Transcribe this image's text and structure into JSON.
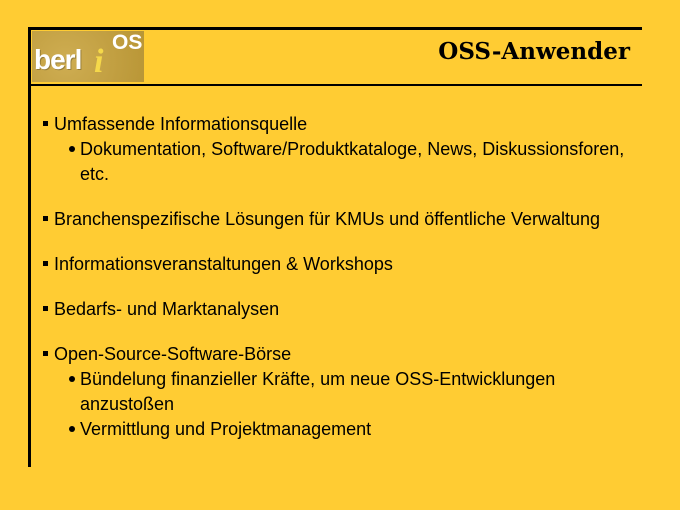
{
  "logo": {
    "text_main": "berl",
    "text_i": "i",
    "text_os": "OS"
  },
  "slide": {
    "title": "OSS-Anwender",
    "items": [
      {
        "text": "Umfassende Informationsquelle",
        "subitems": [
          "Dokumentation, Software/Produktkataloge, News, Diskussionsforen, etc."
        ]
      },
      {
        "text": "Branchenspezifische Lösungen für KMUs und öffentliche Verwaltung",
        "subitems": []
      },
      {
        "text": "Informationsveranstaltungen & Workshops",
        "subitems": []
      },
      {
        "text": "Bedarfs- und Marktanalysen",
        "subitems": []
      },
      {
        "text": "Open-Source-Software-Börse",
        "subitems": [
          "Bündelung finanzieller Kräfte, um neue OSS-Entwicklungen anzustoßen",
          "Vermittlung und Projektmanagement"
        ]
      }
    ]
  },
  "colors": {
    "background": "#ffcc33",
    "rules": "#000000",
    "logo_bg": "#c8a23a"
  }
}
